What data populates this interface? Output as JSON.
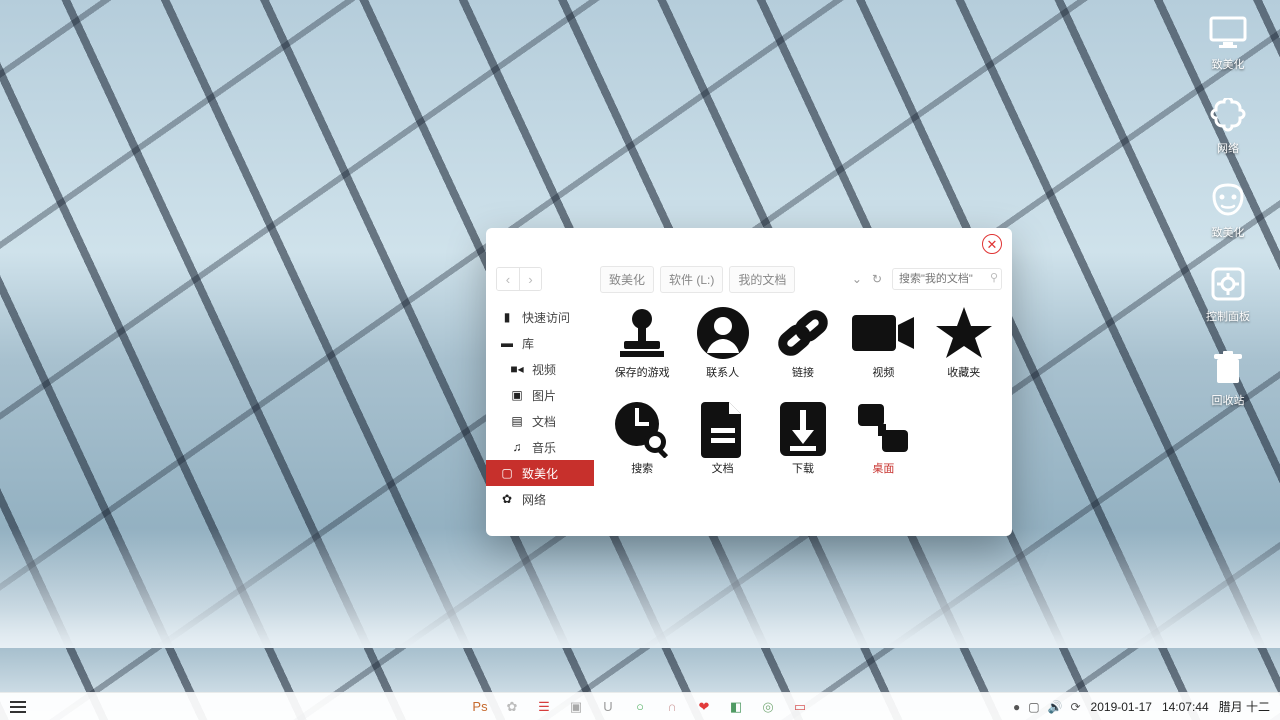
{
  "desktop": {
    "items": [
      {
        "name": "monitor-icon",
        "label": "致美化"
      },
      {
        "name": "puzzle-icon",
        "label": "网络"
      },
      {
        "name": "mask-icon",
        "label": "致美化"
      },
      {
        "name": "gear-icon",
        "label": "控制面板"
      },
      {
        "name": "trash-icon",
        "label": "回收站"
      }
    ]
  },
  "win": {
    "breadcrumbs": [
      "致美化",
      "软件 (L:)",
      "我的文档"
    ],
    "search_placeholder": "搜索\"我的文档\"",
    "sidebar": {
      "quick": "快速访问",
      "library": "库",
      "video": "视频",
      "pictures": "图片",
      "documents": "文档",
      "music": "音乐",
      "beautify": "致美化",
      "network": "网络"
    },
    "files": [
      {
        "name": "saved-games",
        "label": "保存的游戏"
      },
      {
        "name": "contacts",
        "label": "联系人"
      },
      {
        "name": "links",
        "label": "链接"
      },
      {
        "name": "video",
        "label": "视频"
      },
      {
        "name": "favorites",
        "label": "收藏夹"
      },
      {
        "name": "search",
        "label": "搜索"
      },
      {
        "name": "docs",
        "label": "文档"
      },
      {
        "name": "downloads",
        "label": "下载"
      },
      {
        "name": "desktop",
        "label": "桌面"
      }
    ]
  },
  "taskbar": {
    "date": "2019-01-17",
    "time": "14:07:44",
    "lunar": "腊月 十二",
    "center_apps": [
      {
        "name": "ps-icon",
        "glyph": "Ps",
        "color": "#c66a2e"
      },
      {
        "name": "gear2-icon",
        "glyph": "✿",
        "color": "#bdbdbd"
      },
      {
        "name": "zz-icon",
        "glyph": "☰",
        "color": "#d63d3d"
      },
      {
        "name": "square-icon",
        "glyph": "▣",
        "color": "#a9a9a9"
      },
      {
        "name": "u-icon",
        "glyph": "U",
        "color": "#9c9c9c"
      },
      {
        "name": "ring-icon",
        "glyph": "○",
        "color": "#4faf5f"
      },
      {
        "name": "headset-icon",
        "glyph": "∩",
        "color": "#cfa0a0"
      },
      {
        "name": "heart-icon",
        "glyph": "❤",
        "color": "#e23b3b"
      },
      {
        "name": "camera-icon",
        "glyph": "◧",
        "color": "#4f9a63"
      },
      {
        "name": "compass-icon",
        "glyph": "◎",
        "color": "#7eae7e"
      },
      {
        "name": "display-icon",
        "glyph": "▭",
        "color": "#d85a5a"
      }
    ]
  }
}
